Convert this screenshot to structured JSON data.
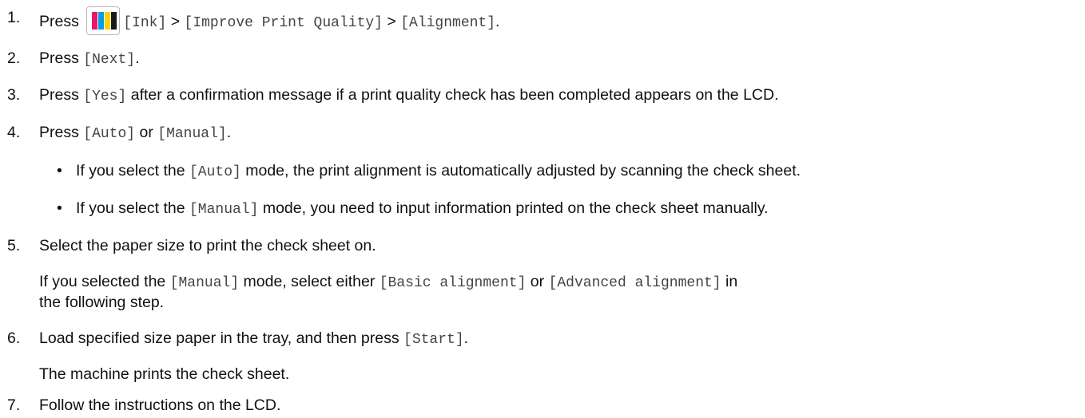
{
  "steps": [
    {
      "number": "1.",
      "press": "Press",
      "icon": "ink-icon",
      "ink_colors": [
        "#e8166c",
        "#00a0e4",
        "#ffd200",
        "#1a1a1a"
      ],
      "ink": "[Ink]",
      "sep1": ">",
      "improve": "[Improve Print Quality]",
      "sep2": ">",
      "alignment": "[Alignment]",
      "end": "."
    },
    {
      "number": "2.",
      "press": "Press",
      "next": "[Next]",
      "end": "."
    },
    {
      "number": "3.",
      "press": "Press",
      "yes": "[Yes]",
      "rest": "after a confirmation message if a print quality check has been completed appears on the LCD."
    },
    {
      "number": "4.",
      "press": "Press",
      "auto": "[Auto]",
      "or": "or",
      "manual": "[Manual]",
      "end": ".",
      "bullets": [
        {
          "bullet": "•",
          "pre": "If you select the",
          "mode": "[Auto]",
          "post": "mode, the print alignment is automatically adjusted by scanning the check sheet."
        },
        {
          "bullet": "•",
          "pre": "If you select the",
          "mode": "[Manual]",
          "post": "mode, you need to input information printed on the check sheet manually."
        }
      ]
    },
    {
      "number": "5.",
      "text": "Select the paper size to print the check sheet on.",
      "note_pre": "If you selected the",
      "note_manual": "[Manual]",
      "note_mid": "mode, select either",
      "note_basic": "[Basic alignment]",
      "note_or": "or",
      "note_advanced": "[Advanced alignment]",
      "note_in": "in",
      "note_line2": "the following step."
    },
    {
      "number": "6.",
      "text": "Load specified size paper in the tray, and then press",
      "start": "[Start]",
      "end": ".",
      "result": "The machine prints the check sheet."
    },
    {
      "number": "7.",
      "text": "Follow the instructions on the LCD."
    }
  ]
}
